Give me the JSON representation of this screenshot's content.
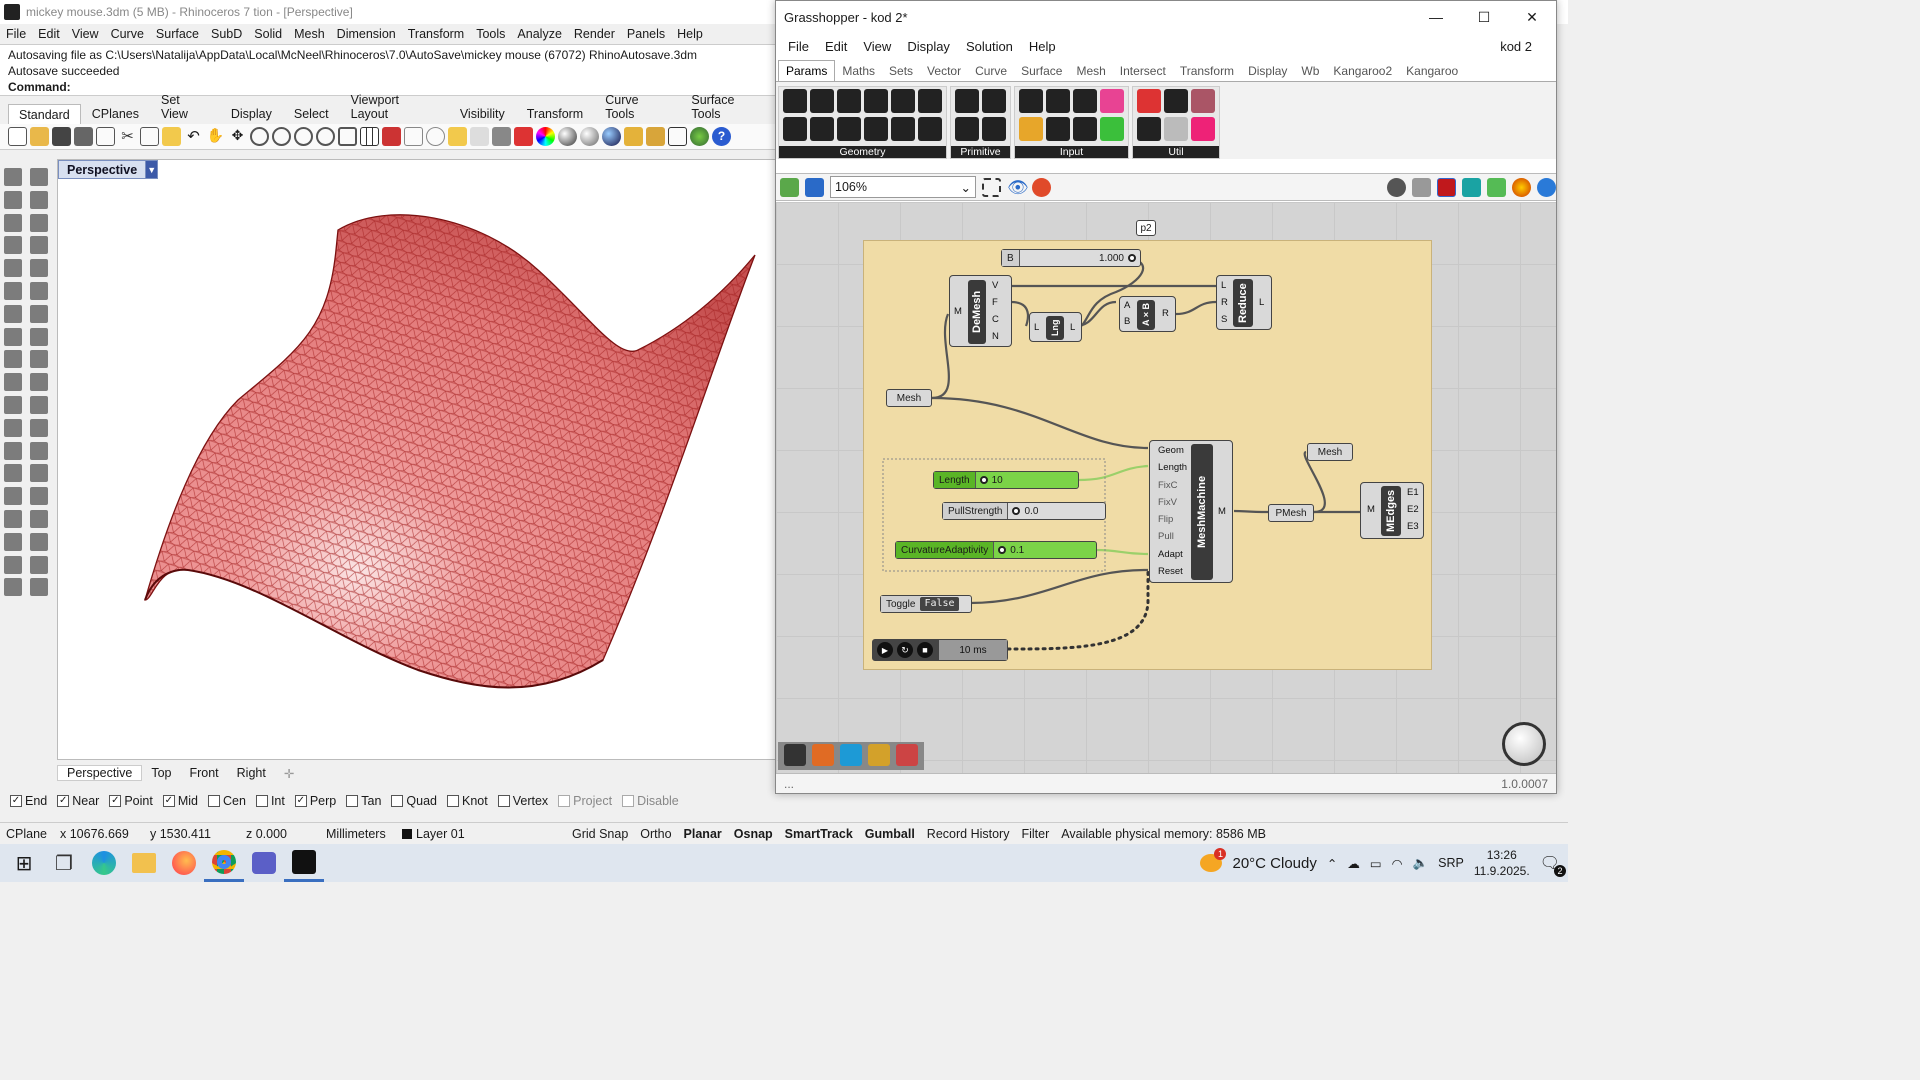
{
  "rhino": {
    "title": "mickey mouse.3dm (5 MB) - Rhinoceros 7 tion - [Perspective]",
    "menu": [
      "File",
      "Edit",
      "View",
      "Curve",
      "Surface",
      "SubD",
      "Solid",
      "Mesh",
      "Dimension",
      "Transform",
      "Tools",
      "Analyze",
      "Render",
      "Panels",
      "Help"
    ],
    "history": [
      "Autosaving file as C:\\Users\\Natalija\\AppData\\Local\\McNeel\\Rhinoceros\\7.0\\AutoSave\\mickey mouse (67072) RhinoAutosave.3dm",
      "Autosave succeeded"
    ],
    "command_label": "Command:",
    "toolbar_tabs": [
      "Standard",
      "CPlanes",
      "Set View",
      "Display",
      "Select",
      "Viewport Layout",
      "Visibility",
      "Transform",
      "Curve Tools",
      "Surface Tools"
    ],
    "viewport_title": "Perspective",
    "viewport_tabs": [
      "Perspective",
      "Top",
      "Front",
      "Right"
    ],
    "osnap": [
      {
        "label": "End",
        "checked": true
      },
      {
        "label": "Near",
        "checked": true
      },
      {
        "label": "Point",
        "checked": true
      },
      {
        "label": "Mid",
        "checked": true
      },
      {
        "label": "Cen",
        "checked": false
      },
      {
        "label": "Int",
        "checked": false
      },
      {
        "label": "Perp",
        "checked": true
      },
      {
        "label": "Tan",
        "checked": false
      },
      {
        "label": "Quad",
        "checked": false
      },
      {
        "label": "Knot",
        "checked": false
      },
      {
        "label": "Vertex",
        "checked": false
      },
      {
        "label": "Project",
        "checked": false
      },
      {
        "label": "Disable",
        "checked": false
      }
    ],
    "status": {
      "cplane": "CPlane",
      "x": "x 10676.669",
      "y": "y 1530.411",
      "z": "z 0.000",
      "units": "Millimeters",
      "layer": "Layer 01",
      "toggles": [
        "Grid Snap",
        "Ortho",
        "Planar",
        "Osnap",
        "SmartTrack",
        "Gumball",
        "Record History",
        "Filter"
      ],
      "memory": "Available physical memory: 8586 MB"
    },
    "mesh_color": "#c83a3a"
  },
  "gh": {
    "title": "Grasshopper - kod 2*",
    "window_controls": [
      "—",
      "☐",
      "✕"
    ],
    "menu": [
      "File",
      "Edit",
      "View",
      "Display",
      "Solution",
      "Help"
    ],
    "doc_name": "kod 2",
    "tabs": [
      "Params",
      "Maths",
      "Sets",
      "Vector",
      "Curve",
      "Surface",
      "Mesh",
      "Intersect",
      "Transform",
      "Display",
      "Wb",
      "Kangaroo2",
      "Kangaroo"
    ],
    "ribbon_groups": [
      "Geometry",
      "Primitive",
      "Input",
      "Util"
    ],
    "zoom": "106%",
    "canvas": {
      "b_slider": {
        "label": "B",
        "value": "1.000"
      },
      "p2": "p2",
      "demesh": {
        "name": "DeMesh",
        "in": "M",
        "outs": [
          "V",
          "F",
          "C",
          "N"
        ]
      },
      "lng": {
        "name": "Lng",
        "in": "L",
        "out": "L"
      },
      "axb": {
        "name": "A×B",
        "ins": [
          "A",
          "B"
        ],
        "out": "R"
      },
      "reduce": {
        "name": "Reduce",
        "ins": [
          "L",
          "R",
          "S"
        ],
        "out": "L"
      },
      "mesh_param": "Mesh",
      "length_slider": {
        "label": "Length",
        "value": "10"
      },
      "pull_slider": {
        "label": "PullStrength",
        "value": "0.0"
      },
      "curv_slider": {
        "label": "CurvatureAdaptivity",
        "value": "0.1"
      },
      "toggle": {
        "label": "Toggle",
        "value": "False"
      },
      "timer": {
        "value": "10 ms"
      },
      "meshmachine": {
        "name": "MeshMachine",
        "ins": [
          "Geom",
          "Length",
          "FixC",
          "FixV",
          "Flip",
          "Pull",
          "Adapt",
          "Reset"
        ],
        "out": "M"
      },
      "mesh_out": "Mesh",
      "pmesh": "PMesh",
      "medges": {
        "name": "MEdges",
        "in": "M",
        "outs": [
          "E1",
          "E2",
          "E3"
        ]
      }
    },
    "status_left": "...",
    "version": "1.0.0007"
  },
  "taskbar": {
    "weather": "20°C Cloudy",
    "lang": "SRP",
    "time": "13:26",
    "date": "11.9.2025.",
    "notif_count": "2"
  }
}
